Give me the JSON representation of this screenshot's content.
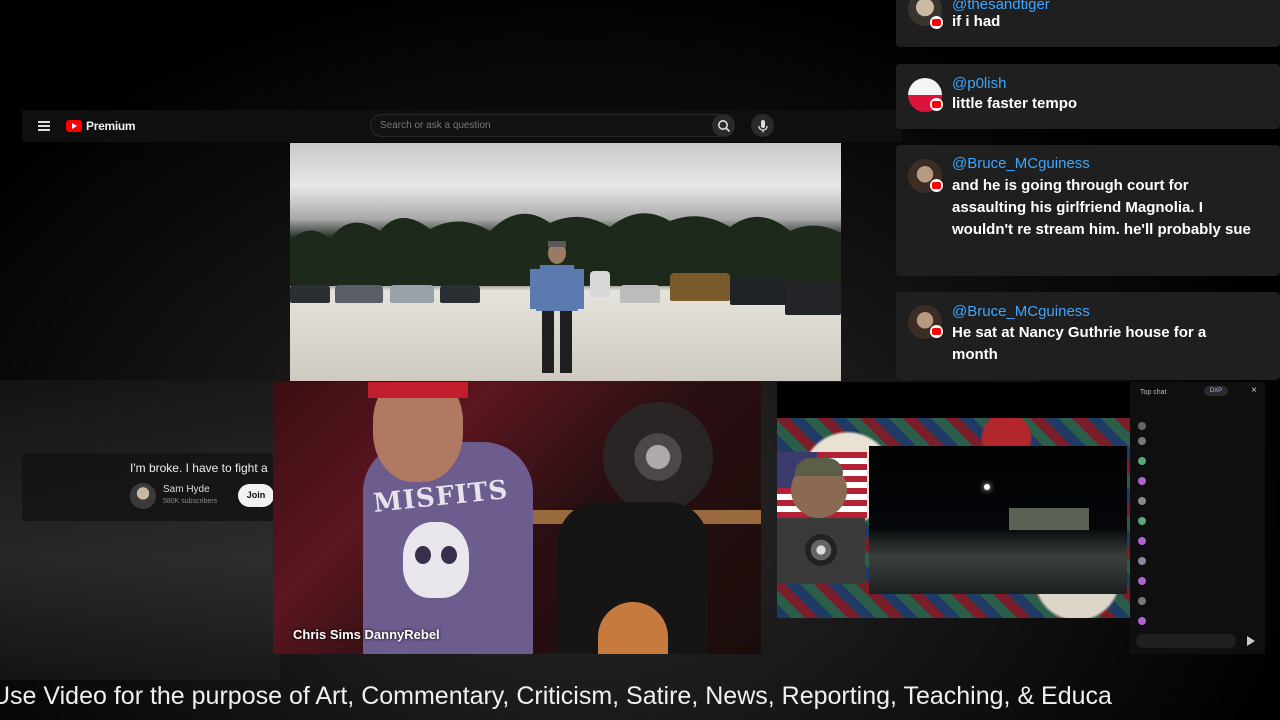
{
  "youtube": {
    "brand": "Premium",
    "search_placeholder": "Search or ask a question"
  },
  "side_video": {
    "title": "I'm broke. I have to fight a",
    "channel": "Sam Hyde",
    "subscribers": "580K subscribers",
    "join_label": "Join"
  },
  "cam1": {
    "name_overlay": "Chris Sims DannyRebel",
    "shirt_text": "MISFITS"
  },
  "chat_panel": {
    "header": "Top chat",
    "pill": "DXP",
    "close": "×"
  },
  "messages": [
    {
      "user": "@thesandtiger",
      "text": "if i had"
    },
    {
      "user": "@p0lish",
      "text": "little faster tempo"
    },
    {
      "user": "@Bruce_MCguiness",
      "text": "and he is going through court for assaulting his girlfriend Magnolia. I wouldn't re stream him. he'll probably sue"
    },
    {
      "user": "@Bruce_MCguiness",
      "text": "He sat at Nancy Guthrie house for a month"
    }
  ],
  "ticker": {
    "text": "Use Video for the purpose of Art, Commentary, Criticism, Satire, News, Reporting, Teaching, & Educa"
  },
  "colors": {
    "youtube_red": "#ff0000",
    "username_blue": "#3ea6ff",
    "message_bg": "#1f1f1f"
  },
  "icons": [
    "menu-icon",
    "youtube-logo-icon",
    "search-icon",
    "mic-icon",
    "close-icon",
    "send-icon",
    "youtube-badge-icon"
  ]
}
